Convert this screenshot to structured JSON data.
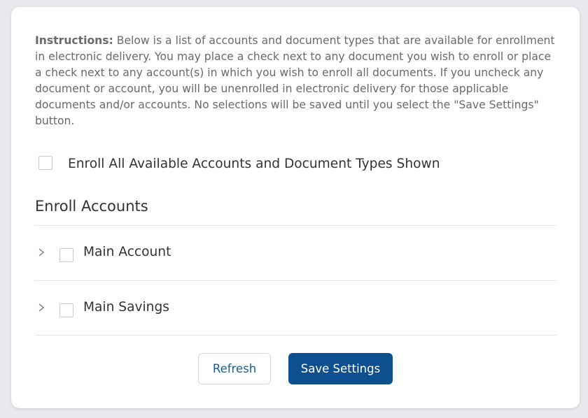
{
  "instructions": {
    "label": "Instructions:",
    "text": " Below is a list of accounts and document types that are available for enrollment in electronic delivery. You may place a check next to any document you wish to enroll or place a check next to any account(s) in which you wish to enroll all documents. If you uncheck any document or account, you will be unenrolled in electronic delivery for those applicable documents and/or accounts. No selections will be saved until you select the \"Save Settings\" button."
  },
  "enroll_all": {
    "label": "Enroll All Available Accounts and Document Types Shown",
    "checked": false
  },
  "section": {
    "title": "Enroll Accounts"
  },
  "accounts": [
    {
      "name": "Main Account",
      "checked": false,
      "expanded": false
    },
    {
      "name": "Main Savings",
      "checked": false,
      "expanded": false
    }
  ],
  "buttons": {
    "refresh": "Refresh",
    "save": "Save Settings"
  },
  "colors": {
    "primary": "#0e4f8f",
    "link": "#1e5b96"
  }
}
